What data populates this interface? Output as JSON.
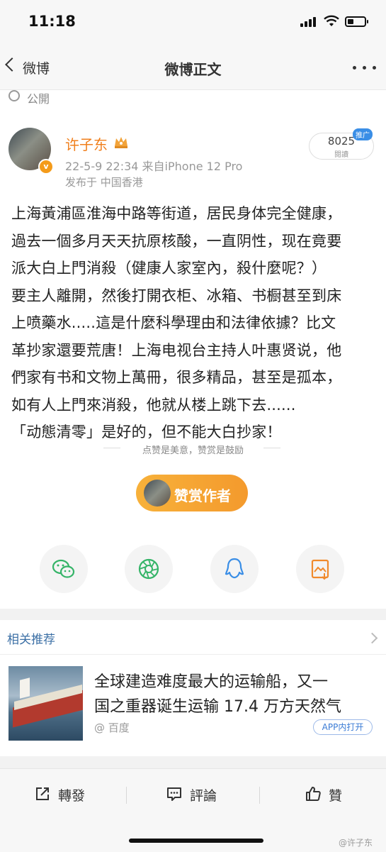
{
  "status": {
    "time": "11:18"
  },
  "nav": {
    "back_label": "微博",
    "title": "微博正文"
  },
  "visibility": {
    "label": "公開"
  },
  "post": {
    "author": "许子东",
    "avatar_badge": "v",
    "meta": "22-5-9 22:34  来自iPhone 12 Pro",
    "location": "发布于 中国香港",
    "read_count": "8025",
    "read_label": "閱讀",
    "promo_tag": "推广",
    "body_lines": [
      "上海黃浦區淮海中路等街道，居民身体完全健康，",
      "過去一個多月天天抗原核酸，一直阴性，现在竟要",
      "派大白上門消殺（健康人家室內，殺什麼呢？）",
      "要主人離開，然後打開衣柜、冰箱、书橱甚至到床",
      "上喷藥水.....這是什麼科學理由和法律依據？比文",
      "革抄家還要荒唐！上海电视台主持人叶惠贤说，他",
      "們家有书和文物上萬冊，很多精品，甚至是孤本，",
      "如有人上門來消殺，他就从楼上跳下去......",
      "「动態清零」是好的，但不能大白抄家！"
    ]
  },
  "reward": {
    "caption": "点赞是美意，赞赏是鼓励",
    "button_label": "赞赏作者"
  },
  "share": {
    "icons": [
      "wechat-icon",
      "moments-icon",
      "qq-icon",
      "save-image-icon"
    ],
    "colors": {
      "wechat": "#35b468",
      "moments": "#35b468",
      "qq": "#3a8ee6",
      "save": "#f08a2c"
    }
  },
  "recommend": {
    "title": "相关推荐",
    "headline_lines": [
      "全球建造难度最大的运输船，又一",
      "国之重器诞生运输 17.4 万方天然气"
    ],
    "source": "@ 百度",
    "app_open": "APP内打开"
  },
  "actions": {
    "repost": "轉發",
    "comment": "評論",
    "like": "贊"
  },
  "watermark": "@许子东",
  "colors": {
    "author": "#f07f1c",
    "link": "#3b6fa5",
    "reward": "#f49a2d"
  }
}
